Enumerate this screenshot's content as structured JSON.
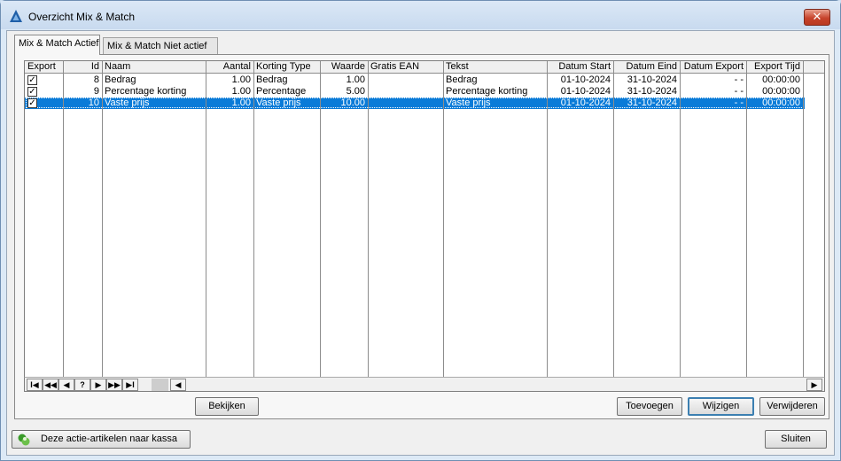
{
  "window": {
    "title": "Overzicht Mix & Match",
    "close_label": "✕"
  },
  "tabs": [
    {
      "label": "Mix & Match Actief",
      "active": true
    },
    {
      "label": "Mix & Match Niet actief",
      "active": false
    }
  ],
  "grid": {
    "columns": [
      "Export",
      "Id",
      "Naam",
      "Aantal",
      "Korting Type",
      "Waarde",
      "Gratis EAN",
      "Tekst",
      "Datum Start",
      "Datum Eind",
      "Datum Export",
      "Export Tijd"
    ],
    "rows": [
      {
        "export": "✓",
        "id": "8",
        "naam": "Bedrag",
        "aantal": "1.00",
        "korting_type": "Bedrag",
        "waarde": "1.00",
        "gratis_ean": "",
        "tekst": "Bedrag",
        "datum_start": "01-10-2024",
        "datum_eind": "31-10-2024",
        "datum_export": "- -",
        "export_tijd": "00:00:00"
      },
      {
        "export": "✓",
        "id": "9",
        "naam": "Percentage korting",
        "aantal": "1.00",
        "korting_type": "Percentage",
        "waarde": "5.00",
        "gratis_ean": "",
        "tekst": "Percentage korting",
        "datum_start": "01-10-2024",
        "datum_eind": "31-10-2024",
        "datum_export": "- -",
        "export_tijd": "00:00:00"
      },
      {
        "export": "✓",
        "id": "10",
        "naam": "Vaste prijs",
        "aantal": "1.00",
        "korting_type": "Vaste prijs",
        "waarde": "10.00",
        "gratis_ean": "",
        "tekst": "Vaste prijs",
        "datum_start": "01-10-2024",
        "datum_eind": "31-10-2024",
        "datum_export": "- -",
        "export_tijd": "00:00:00",
        "selected": true
      }
    ]
  },
  "navigator": {
    "first": "I◀",
    "prev_page": "◀◀",
    "prev": "◀",
    "help": "?",
    "next": "▶",
    "next_page": "▶▶",
    "last": "▶I",
    "scroll_left": "◀",
    "scroll_right": "▶"
  },
  "buttons": {
    "bekijken": "Bekijken",
    "toevoegen": "Toevoegen",
    "wijzigen": "Wijzigen",
    "verwijderen": "Verwijderen",
    "naar_kassa": "Deze actie-artikelen naar kassa",
    "sluiten": "Sluiten"
  },
  "colors": {
    "selection": "#0a7bd8",
    "titlebar": "#c8daef",
    "close": "#c7442c"
  }
}
